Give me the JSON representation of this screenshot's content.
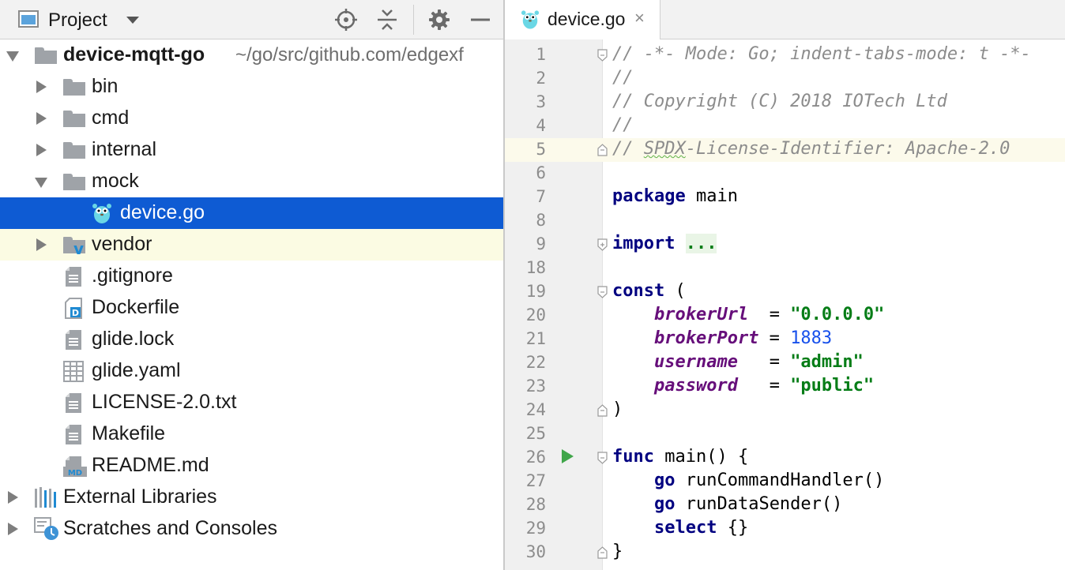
{
  "project_panel": {
    "title": "Project",
    "toolbar_icons": [
      "locate-icon",
      "collapse-all-icon",
      "gear-icon",
      "hide-icon"
    ],
    "root": {
      "name": "device-mqtt-go",
      "path": "~/go/src/github.com/edgexf"
    },
    "items": [
      {
        "label": "bin"
      },
      {
        "label": "cmd"
      },
      {
        "label": "internal"
      },
      {
        "label": "mock"
      },
      {
        "label": "device.go"
      },
      {
        "label": "vendor"
      },
      {
        "label": ".gitignore"
      },
      {
        "label": "Dockerfile"
      },
      {
        "label": "glide.lock"
      },
      {
        "label": "glide.yaml"
      },
      {
        "label": "LICENSE-2.0.txt"
      },
      {
        "label": "Makefile"
      },
      {
        "label": "README.md"
      },
      {
        "label": "External Libraries"
      },
      {
        "label": "Scratches and Consoles"
      }
    ]
  },
  "editor": {
    "tab": {
      "label": "device.go",
      "close_glyph": "×"
    },
    "lines": [
      {
        "n": "1",
        "t": [
          [
            "c-comment",
            "// -*- Mode: Go; indent-tabs-mode: t -*-"
          ]
        ]
      },
      {
        "n": "2",
        "t": [
          [
            "c-comment",
            "//"
          ]
        ]
      },
      {
        "n": "3",
        "t": [
          [
            "c-comment",
            "// Copyright (C) 2018 IOTech Ltd"
          ]
        ]
      },
      {
        "n": "4",
        "t": [
          [
            "c-comment",
            "//"
          ]
        ]
      },
      {
        "n": "5",
        "t": [
          [
            "c-comment",
            "// "
          ],
          [
            "c-comment spell",
            "SPDX"
          ],
          [
            "c-comment",
            "-License-Identifier: Apache-2.0"
          ]
        ]
      },
      {
        "n": "6",
        "t": []
      },
      {
        "n": "7",
        "t": [
          [
            "c-kw",
            "package"
          ],
          [
            "",
            " main"
          ]
        ]
      },
      {
        "n": "8",
        "t": []
      },
      {
        "n": "9",
        "t": [
          [
            "c-kw",
            "import"
          ],
          [
            "",
            " "
          ],
          [
            "c-fold",
            "..."
          ]
        ]
      },
      {
        "n": "18",
        "t": []
      },
      {
        "n": "19",
        "t": [
          [
            "c-kw",
            "const"
          ],
          [
            "",
            " ("
          ]
        ]
      },
      {
        "n": "20",
        "t": [
          [
            "",
            "    "
          ],
          [
            "c-const",
            "brokerUrl"
          ],
          [
            "",
            "  = "
          ],
          [
            "c-str",
            "\"0.0.0.0\""
          ]
        ]
      },
      {
        "n": "21",
        "t": [
          [
            "",
            "    "
          ],
          [
            "c-const",
            "brokerPort"
          ],
          [
            "",
            " = "
          ],
          [
            "c-num",
            "1883"
          ]
        ]
      },
      {
        "n": "22",
        "t": [
          [
            "",
            "    "
          ],
          [
            "c-const",
            "username"
          ],
          [
            "",
            "   = "
          ],
          [
            "c-str",
            "\"admin\""
          ]
        ]
      },
      {
        "n": "23",
        "t": [
          [
            "",
            "    "
          ],
          [
            "c-const",
            "password"
          ],
          [
            "",
            "   = "
          ],
          [
            "c-str",
            "\"public\""
          ]
        ]
      },
      {
        "n": "24",
        "t": [
          [
            "",
            ")"
          ]
        ]
      },
      {
        "n": "25",
        "t": []
      },
      {
        "n": "26",
        "t": [
          [
            "c-kw",
            "func"
          ],
          [
            "",
            " main() {"
          ]
        ]
      },
      {
        "n": "27",
        "t": [
          [
            "",
            "    "
          ],
          [
            "c-kw",
            "go"
          ],
          [
            "",
            " runCommandHandler()"
          ]
        ]
      },
      {
        "n": "28",
        "t": [
          [
            "",
            "    "
          ],
          [
            "c-kw",
            "go"
          ],
          [
            "",
            " runDataSender()"
          ]
        ]
      },
      {
        "n": "29",
        "t": [
          [
            "",
            "    "
          ],
          [
            "c-kw",
            "select"
          ],
          [
            "",
            " {}"
          ]
        ]
      },
      {
        "n": "30",
        "t": [
          [
            "",
            "}"
          ]
        ]
      }
    ]
  },
  "colors": {
    "selection": "#0e5bd3",
    "row_highlight": "#fbfbe3",
    "current_line": "#fcfaeb",
    "keyword": "#000080",
    "string": "#067d17",
    "number": "#1750eb",
    "constant": "#660e7a",
    "comment": "#8c8c8c",
    "run_marker": "#40a64a"
  }
}
